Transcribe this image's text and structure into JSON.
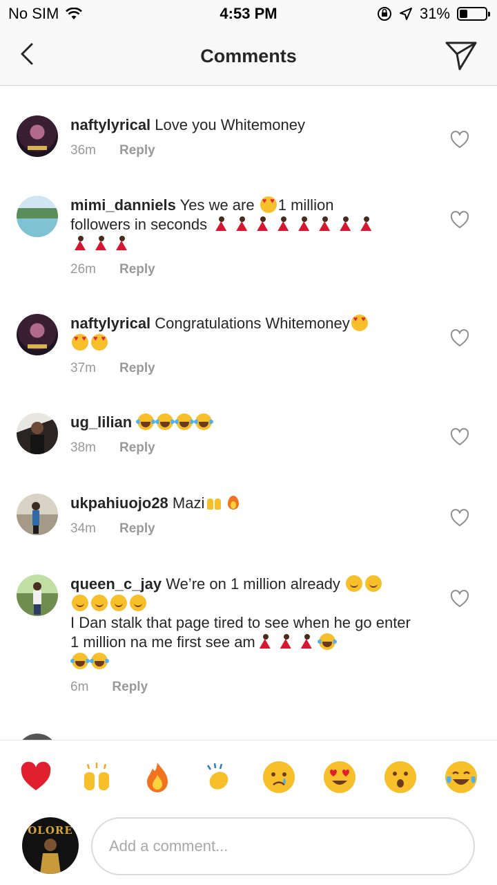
{
  "status_bar": {
    "carrier": "No SIM",
    "time": "4:53 PM",
    "battery_text": "31%",
    "battery_level": 0.31
  },
  "header": {
    "title": "Comments",
    "back_icon": "chevron-left-icon",
    "send_icon": "paper-plane-icon"
  },
  "comments": [
    {
      "username": "naftylyrical",
      "text": "Love you Whitemoney",
      "time": "36m",
      "reply": "Reply"
    },
    {
      "username": "mimi_danniels",
      "text_a": "Yes we are",
      "text_b": "1 million",
      "text_c": "followers in seconds",
      "time": "26m",
      "reply": "Reply"
    },
    {
      "username": "naftylyrical",
      "text": "Congratulations Whitemoney",
      "time": "37m",
      "reply": "Reply"
    },
    {
      "username": "ug_lilian",
      "text": "",
      "time": "38m",
      "reply": "Reply"
    },
    {
      "username": "ukpahiuojo28",
      "text": "Mazi",
      "time": "34m",
      "reply": "Reply"
    },
    {
      "username": "queen_c_jay",
      "text_a": "We’re on 1 million already",
      "text_b": "I Dan stalk that page tired to see when he go enter 1 million na me first see am",
      "time": "6m",
      "reply": "Reply"
    }
  ],
  "reactions": [
    "heart",
    "raising-hands",
    "fire",
    "clapping-hands",
    "crying-face",
    "heart-eyes",
    "surprised-face",
    "tears-of-joy"
  ],
  "composer": {
    "placeholder": "Add a comment...",
    "avatar_word": "OLORE"
  },
  "colors": {
    "primary_text": "#262626",
    "secondary_text": "#999999",
    "heart_red": "#ed4956",
    "emoji_yellow": "#f7c02b"
  }
}
